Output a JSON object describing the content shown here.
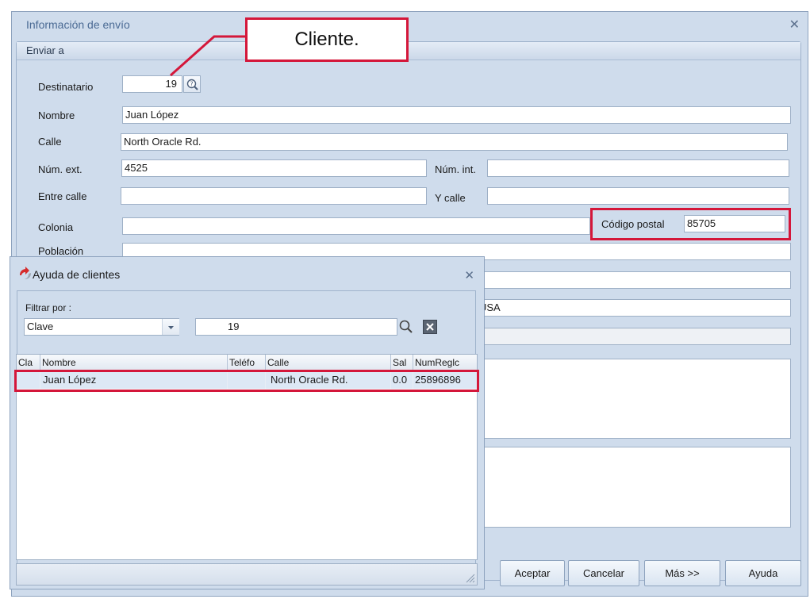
{
  "window": {
    "title": "Información de envío",
    "close": "✕"
  },
  "group": {
    "header": "Enviar a"
  },
  "callout": {
    "text": "Cliente."
  },
  "form": {
    "destinatario": {
      "label": "Destinatario",
      "value": "19"
    },
    "nombre": {
      "label": "Nombre",
      "value": "Juan López"
    },
    "calle": {
      "label": "Calle",
      "value": "North Oracle Rd."
    },
    "num_ext": {
      "label": "Núm. ext.",
      "value": "4525"
    },
    "num_int": {
      "label": "Núm. int.",
      "value": ""
    },
    "entre_calle": {
      "label": "Entre calle",
      "value": ""
    },
    "y_calle": {
      "label": "Y calle",
      "value": ""
    },
    "colonia": {
      "label": "Colonia",
      "value": ""
    },
    "codigo_postal": {
      "label": "Código postal",
      "value": "85705"
    },
    "poblacion": {
      "label": "Población",
      "value": ""
    },
    "pais": {
      "value": "USA"
    }
  },
  "buttons": {
    "aceptar": "Aceptar",
    "cancelar": "Cancelar",
    "mas": "Más >>",
    "ayuda": "Ayuda"
  },
  "dialog": {
    "title": "Ayuda de clientes",
    "close": "✕",
    "filter_label": "Filtrar por :",
    "filter_select": "Clave",
    "filter_value": "19",
    "columns": [
      "Cla",
      "Nombre",
      "Teléfo",
      "Calle",
      "Sal",
      "NumReglc"
    ],
    "rows": [
      {
        "clave": "",
        "nombre": "Juan López",
        "telefono": "",
        "calle": "North Oracle Rd.",
        "saldo": "0.0",
        "numreg": "25896896"
      }
    ]
  },
  "icons": {
    "lookup": "help-lookup-icon",
    "search": "search-icon",
    "clear": "clear-x-icon",
    "dialog": "customer-help-icon"
  },
  "colors": {
    "highlight": "#d4173a",
    "window_bg": "#cfdcec",
    "selected_row": "#dde8f5"
  }
}
